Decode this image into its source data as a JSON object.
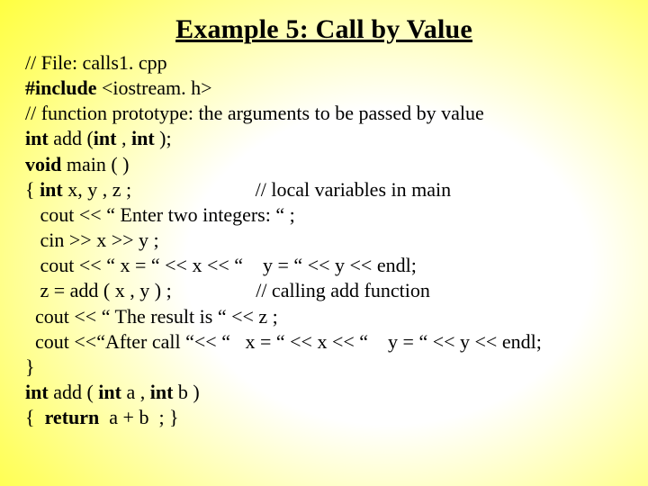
{
  "title": "Example 5: Call by Value",
  "lines": {
    "l1": "// File: calls1. cpp",
    "l2a": "#include",
    "l2b": " <iostream. h>",
    "l3": "// function prototype: the arguments to be passed by value",
    "l4a": "int",
    "l4b": " add (",
    "l4c": "int",
    "l4d": " , ",
    "l4e": "int",
    "l4f": " );",
    "l5a": "void",
    "l5b": " main ( )",
    "l6a": "{ ",
    "l6b": "int",
    "l6c": " x, y , z ;                         // local variables in main",
    "l7": "   cout << “ Enter two integers: “ ;",
    "l8": "   cin >> x >> y ;",
    "l9": "   cout << “ x = “ << x << “    y = “ << y << endl;",
    "l10": "   z = add ( x , y ) ;                 // calling add function",
    "l11": "  cout << “ The result is “ << z ;",
    "l12": "  cout <<“After call “<< “   x = “ << x << “    y = “ << y << endl;",
    "l13": "}",
    "l14a": "int",
    "l14b": " add ( ",
    "l14c": "int",
    "l14d": " a , ",
    "l14e": "int",
    "l14f": " b )",
    "l15a": "{  ",
    "l15b": "return",
    "l15c": "  a + b  ; }"
  }
}
